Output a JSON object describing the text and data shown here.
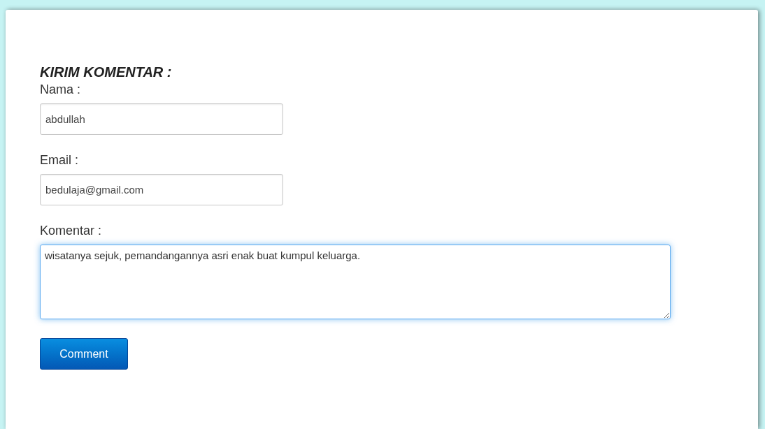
{
  "form": {
    "title": "KIRIM KOMENTAR :",
    "fields": [
      {
        "kind": "input",
        "label": "Nama :",
        "value": "abdullah",
        "focused": false
      },
      {
        "kind": "input",
        "label": "Email :",
        "value": "bedulaja@gmail.com",
        "focused": false
      },
      {
        "kind": "textarea",
        "label": "Komentar :",
        "value": "wisatanya sejuk, pemandangannya asri enak buat kumpul keluarga.",
        "focused": true
      }
    ],
    "submit": "Comment"
  }
}
